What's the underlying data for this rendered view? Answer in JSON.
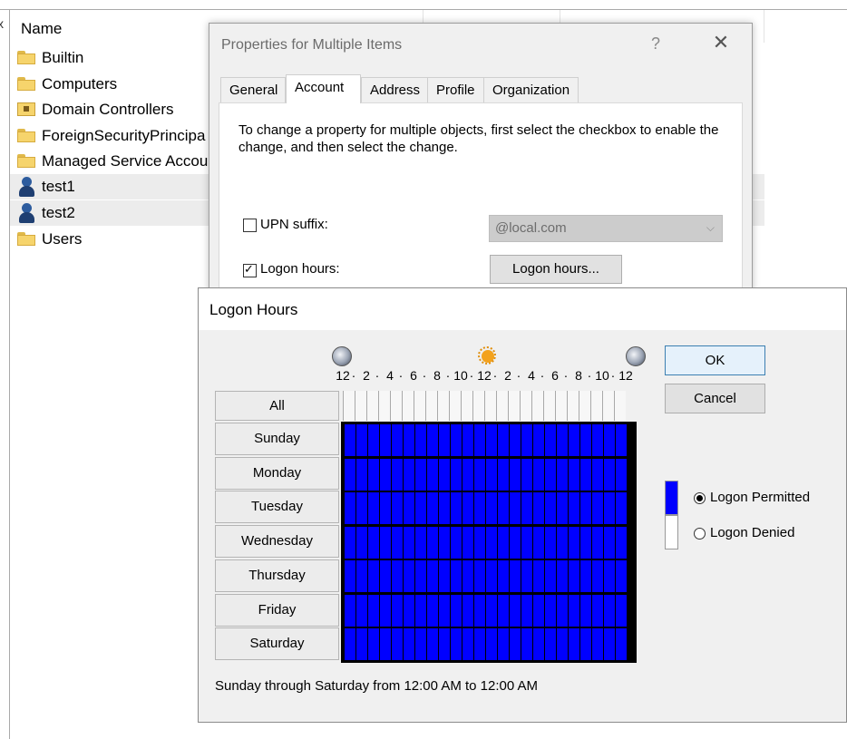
{
  "explorer": {
    "column_header": "Name",
    "truncation_glyph": "x",
    "items": [
      {
        "label": "Builtin",
        "icon": "folder-icon",
        "selected": false
      },
      {
        "label": "Computers",
        "icon": "folder-icon",
        "selected": false
      },
      {
        "label": "Domain Controllers",
        "icon": "domain-controllers-folder-icon",
        "selected": false
      },
      {
        "label": "ForeignSecurityPrincipa",
        "icon": "folder-icon",
        "selected": false
      },
      {
        "label": "Managed Service Accou",
        "icon": "folder-icon",
        "selected": false
      },
      {
        "label": "test1",
        "icon": "user-icon",
        "selected": true
      },
      {
        "label": "test2",
        "icon": "user-icon",
        "selected": true
      },
      {
        "label": "Users",
        "icon": "folder-icon",
        "selected": false
      }
    ]
  },
  "properties_dialog": {
    "title": "Properties for Multiple Items",
    "help_glyph": "?",
    "close_glyph": "✕",
    "tabs": [
      {
        "label": "General",
        "active": false
      },
      {
        "label": "Account",
        "active": true
      },
      {
        "label": "Address",
        "active": false
      },
      {
        "label": "Profile",
        "active": false
      },
      {
        "label": "Organization",
        "active": false
      }
    ],
    "instructions": "To change a property for multiple objects, first select the checkbox to enable the change, and then select the change.",
    "upn_suffix_label": "UPN suffix:",
    "upn_suffix_checked": false,
    "upn_suffix_value": "@local.com",
    "logon_hours_label": "Logon hours:",
    "logon_hours_checked": true,
    "logon_hours_button": "Logon hours..."
  },
  "logon_hours_dialog": {
    "title": "Logon Hours",
    "hour_labels": [
      "12",
      "2",
      "4",
      "6",
      "8",
      "10",
      "12",
      "2",
      "4",
      "6",
      "8",
      "10",
      "12"
    ],
    "hour_separator": "·",
    "all_label": "All",
    "days": [
      "Sunday",
      "Monday",
      "Tuesday",
      "Wednesday",
      "Thursday",
      "Friday",
      "Saturday"
    ],
    "permitted_color": "#0000ff",
    "denied_color": "#ffffff",
    "grid_hours": 24,
    "grid_all_permitted": true,
    "ok_label": "OK",
    "cancel_label": "Cancel",
    "permitted_label": "Logon Permitted",
    "denied_label": "Logon Denied",
    "selected_mode": "permitted",
    "summary": "Sunday through Saturday from 12:00 AM to 12:00 AM"
  }
}
